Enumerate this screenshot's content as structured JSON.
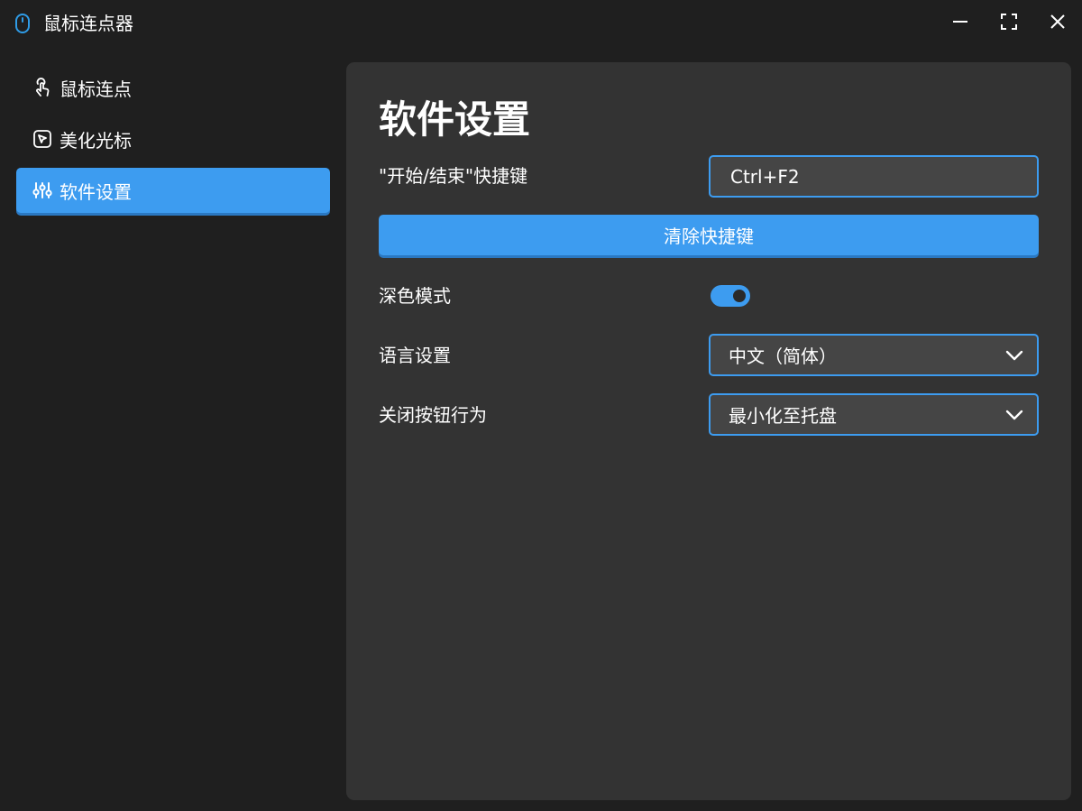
{
  "window": {
    "title": "鼠标连点器",
    "app_icon": "mouse-icon",
    "controls": [
      "minimize-icon",
      "maximize-icon",
      "close-icon"
    ]
  },
  "sidebar": {
    "items": [
      {
        "label": "鼠标连点",
        "icon": "tap-hand-icon",
        "active": false
      },
      {
        "label": "美化光标",
        "icon": "cursor-box-icon",
        "active": false
      },
      {
        "label": "软件设置",
        "icon": "sliders-icon",
        "active": true
      }
    ]
  },
  "settings": {
    "title": "软件设置",
    "hotkey": {
      "label": "\"开始/结束\"快捷键",
      "value": "Ctrl+F2"
    },
    "clear_button": "清除快捷键",
    "dark_mode": {
      "label": "深色模式",
      "enabled": true
    },
    "language": {
      "label": "语言设置",
      "selected": "中文（简体）"
    },
    "close_behavior": {
      "label": "关闭按钮行为",
      "selected": "最小化至托盘"
    }
  },
  "colors": {
    "accent": "#3d9cf0",
    "background": "#1f1f1f",
    "panel": "#333333",
    "input": "#454545"
  }
}
